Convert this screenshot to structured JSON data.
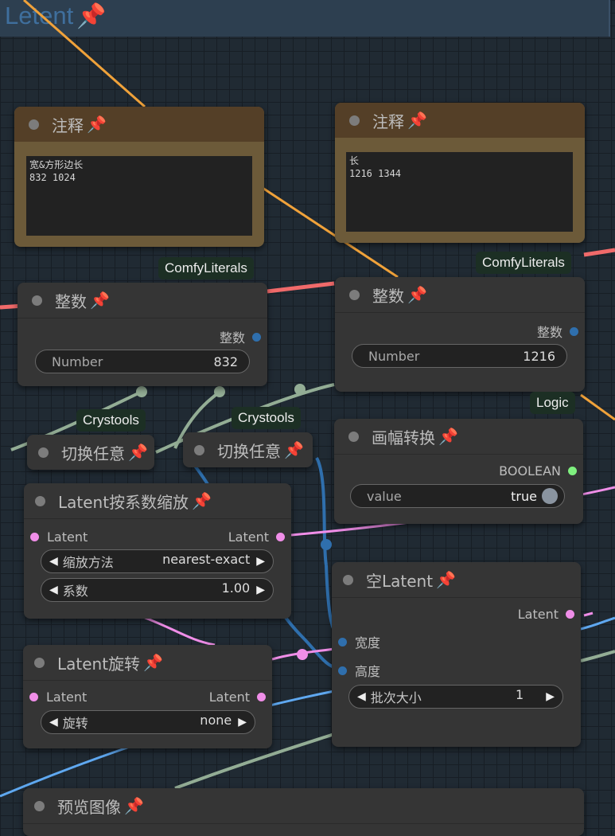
{
  "group": {
    "title": "Letent"
  },
  "notes": [
    {
      "title": "注释",
      "text": "宽&方形边长\n832 1024"
    },
    {
      "title": "注释",
      "text": "长\n1216 1344"
    }
  ],
  "badges": {
    "comfy_literals": "ComfyLiterals",
    "crystools": "Crystools",
    "logic": "Logic"
  },
  "int_nodes": [
    {
      "title": "整数",
      "output": "整数",
      "widget_label": "Number",
      "widget_value": "832"
    },
    {
      "title": "整数",
      "output": "整数",
      "widget_label": "Number",
      "widget_value": "1216"
    }
  ],
  "switch_nodes": [
    {
      "title": "切换任意"
    },
    {
      "title": "切换任意"
    }
  ],
  "boolean_node": {
    "title": "画幅转换",
    "output": "BOOLEAN",
    "widget_label": "value",
    "widget_value": "true"
  },
  "latent_scale": {
    "title": "Latent按系数缩放",
    "input": "Latent",
    "output": "Latent",
    "method_label": "缩放方法",
    "method_value": "nearest-exact",
    "factor_label": "系数",
    "factor_value": "1.00"
  },
  "empty_latent": {
    "title": "空Latent",
    "output": "Latent",
    "width_input": "宽度",
    "height_input": "高度",
    "batch_label": "批次大小",
    "batch_value": "1"
  },
  "latent_rotate": {
    "title": "Latent旋转",
    "input": "Latent",
    "output": "Latent",
    "rotate_label": "旋转",
    "rotate_value": "none"
  },
  "preview": {
    "title": "预览图像"
  },
  "icons": {
    "pin": "📌"
  },
  "colors": {
    "note_body": "#6c5a39",
    "note_head": "#543f27",
    "badge_bg": "#1c2f24",
    "int_socket": "#2f6fad",
    "latent_socket": "#f08ee8",
    "boolean_socket": "#7ff07f"
  }
}
